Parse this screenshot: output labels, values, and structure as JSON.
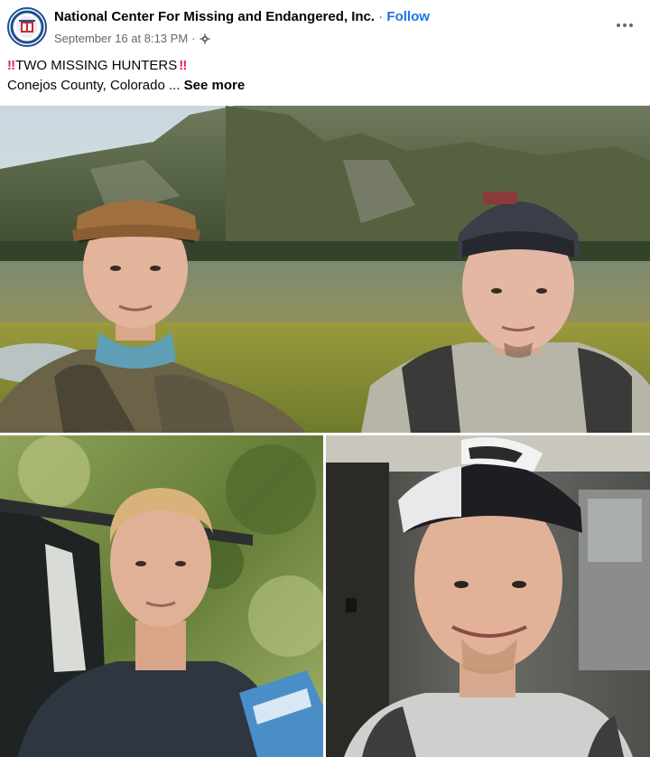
{
  "post": {
    "page_name": "National Center For Missing and Endangered, Inc.",
    "separator": "·",
    "follow_label": "Follow",
    "timestamp": "September 16 at 8:13 PM",
    "meta_separator": "·",
    "audience_icon": "gear-icon",
    "more_icon": "more-options-icon",
    "headline": "TWO MISSING HUNTERS",
    "headline_emoji": "‼",
    "body": "Conejos County, Colorado ...",
    "see_more_label": "See more"
  },
  "photos": {
    "count": 3
  },
  "colors": {
    "link": "#1b74e4",
    "secondary_text": "#65676b",
    "emoji_red": "#e0245e"
  }
}
